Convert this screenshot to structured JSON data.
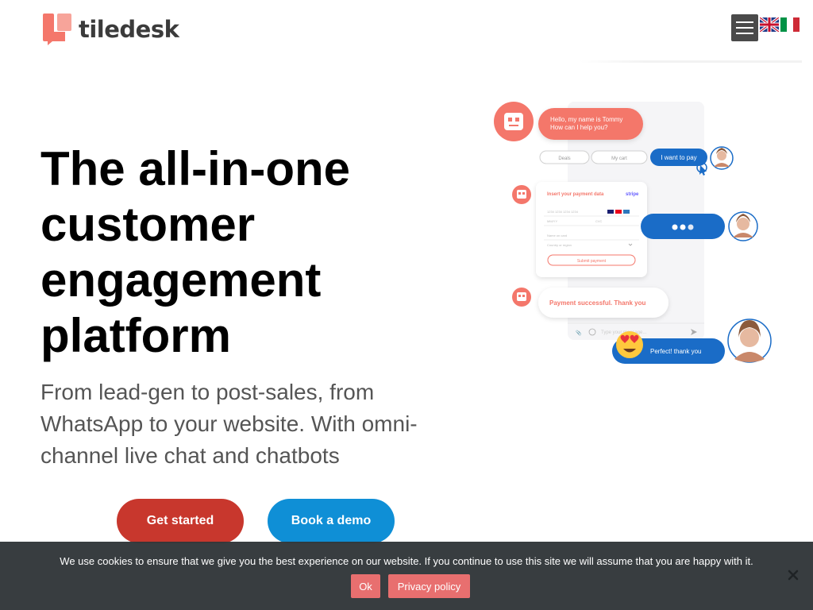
{
  "header": {
    "logo_text": "tiledesk",
    "menu_icon": "hamburger-icon",
    "languages": [
      "en-flag-icon",
      "it-flag-icon"
    ]
  },
  "hero": {
    "title": "The all-in-one customer engagement platform",
    "subtitle": "From lead-gen to post-sales, from WhatsApp to your website. With omni-channel live chat and chatbots",
    "get_started_label": "Get started",
    "book_demo_label": "Book a demo"
  },
  "illustration": {
    "bot_greeting": "Hello, my name is Tommy\nHow can I help you?",
    "bot_greeting_line1": "Hello, my name is Tommy",
    "bot_greeting_line2": "How can I help you?",
    "quick_replies": [
      "Deals",
      "My cart",
      "I want to pay"
    ],
    "payment_form_title": "Insert your payment data",
    "payment_provider": "stripe",
    "card_placeholder": "1234 1234 1234 1234",
    "expiry_placeholder": "MM/YY",
    "cvc_placeholder": "CVC",
    "name_placeholder": "Name on card",
    "country_placeholder": "Country or region",
    "submit_label": "Submit payment",
    "payment_success": "Payment successful. Thank you",
    "input_placeholder": "Type your message...",
    "user_reply": "Perfect! thank you"
  },
  "cookie": {
    "message": "We use cookies to ensure that we give you the best experience on our website. If you continue to use this site we will assume that you are happy with it.",
    "ok_label": "Ok",
    "policy_label": "Privacy policy"
  },
  "colors": {
    "brand": "#f4776b",
    "start_button": "#c8372d",
    "demo_button": "#0f8fd6",
    "chat_blue": "#1a6cc7",
    "cookie_bg": "#32373a"
  }
}
